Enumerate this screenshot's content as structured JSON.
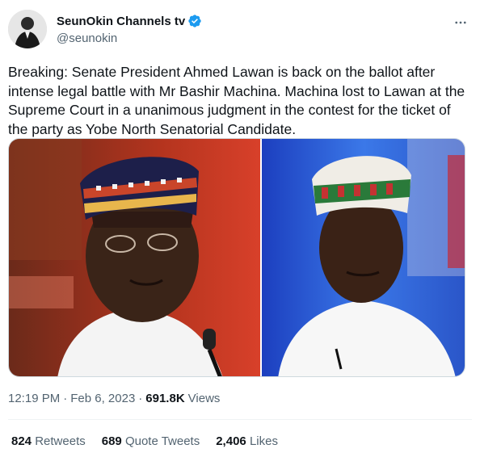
{
  "author": {
    "display_name": "SeunOkin Channels tv",
    "handle": "@seunokin",
    "verified": true
  },
  "icons": {
    "verified": "verified-badge-icon",
    "more": "more-options-icon"
  },
  "tweet": {
    "text": "Breaking: Senate President Ahmed Lawan is back on the ballot after intense legal battle with Mr Bashir Machina. Machina lost to Lawan at the Supreme Court in a unanimous judgment in the contest for the ticket of the party as Yobe North Senatorial Candidate."
  },
  "meta": {
    "time": "12:19 PM",
    "date": "Feb 6, 2023",
    "views_count": "691.8K",
    "views_label": "Views"
  },
  "stats": {
    "retweets_count": "824",
    "retweets_label": "Retweets",
    "quotes_count": "689",
    "quotes_label": "Quote Tweets",
    "likes_count": "2,406",
    "likes_label": "Likes"
  },
  "colors": {
    "accent": "#1d9bf0",
    "text": "#0f1419",
    "secondary": "#536471",
    "border": "#cfd9de"
  }
}
